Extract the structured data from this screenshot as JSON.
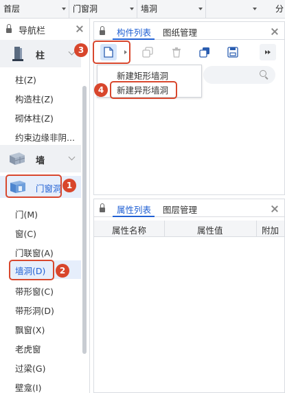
{
  "top_selectors": [
    {
      "label": "首层"
    },
    {
      "label": "门窗洞"
    },
    {
      "label": "墙洞"
    },
    {
      "label": "分"
    }
  ],
  "nav": {
    "title": "导航栏",
    "category_column": {
      "label": "柱"
    },
    "column_items": [
      "柱(Z)",
      "构造柱(Z)",
      "砌体柱(Z)",
      "约束边缘非阴..."
    ],
    "category_wall": {
      "label": "墙"
    },
    "door_window_group": {
      "label": "门窗洞"
    },
    "door_items": [
      "门(M)",
      "窗(C)",
      "门联窗(A)",
      "墙洞(D)",
      "带形窗(C)",
      "带形洞(D)",
      "飘窗(X)",
      "老虎窗",
      "过梁(G)",
      "壁龛(I)"
    ]
  },
  "component_panel": {
    "tabs": [
      "构件列表",
      "图纸管理"
    ],
    "new_menu": [
      "新建矩形墙洞",
      "新建异形墙洞"
    ]
  },
  "property_panel": {
    "tabs": [
      "属性列表",
      "图层管理"
    ],
    "columns": [
      "属性名称",
      "属性值",
      "附加"
    ]
  },
  "callouts": [
    "1",
    "2",
    "3",
    "4"
  ],
  "colors": {
    "accent": "#1f5fd3",
    "callout": "#d8462c",
    "selected_bg": "#e6eefb"
  }
}
